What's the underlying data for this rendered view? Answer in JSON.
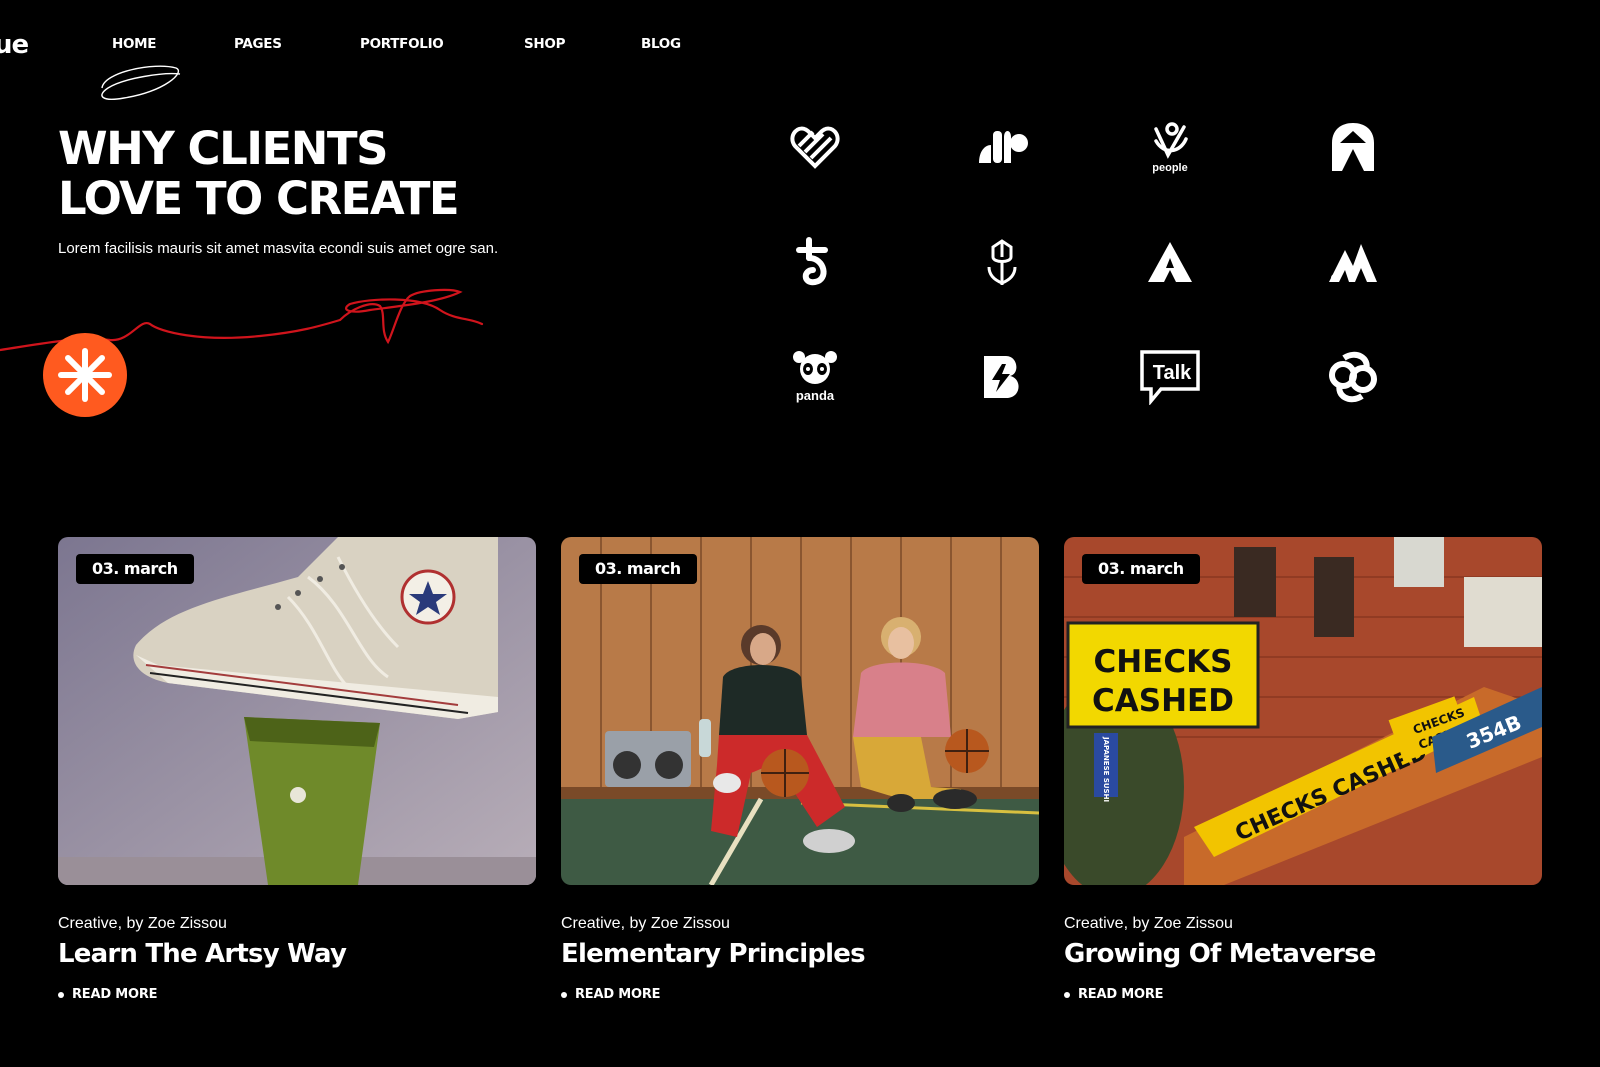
{
  "brand": {
    "logo_fragment": "ue"
  },
  "nav": {
    "items": [
      {
        "label": "HOME",
        "active": true
      },
      {
        "label": "PAGES"
      },
      {
        "label": "PORTFOLIO"
      },
      {
        "label": "SHOP"
      },
      {
        "label": "BLOG"
      }
    ]
  },
  "hero": {
    "title_line1": "WHY CLIENTS",
    "title_line2": "LOVE TO CREATE",
    "subtitle": "Lorem facilisis mauris sit amet masvita econdi suis amet ogre san.",
    "accent_color": "#ff5a1f",
    "scribble_color": "#d0141c"
  },
  "client_logos": [
    {
      "icon": "heart-stripes-icon"
    },
    {
      "icon": "abstract-blob-icon"
    },
    {
      "icon": "people-logo-icon",
      "text": "people"
    },
    {
      "icon": "arch-logo-icon"
    },
    {
      "icon": "t-loop-icon"
    },
    {
      "icon": "tulip-icon"
    },
    {
      "icon": "a-triangle-icon"
    },
    {
      "icon": "m-peaks-icon"
    },
    {
      "icon": "panda-logo-icon",
      "text": "panda"
    },
    {
      "icon": "b-bolt-icon"
    },
    {
      "icon": "talk-bubble-icon",
      "text": "Talk"
    },
    {
      "icon": "knot-icon"
    }
  ],
  "posts": [
    {
      "date": "03. march",
      "meta": "Creative, by Zoe Zissou",
      "title": "Learn The Artsy Way",
      "read_more": "READ MORE",
      "image": "sneaker-photo"
    },
    {
      "date": "03. march",
      "meta": "Creative, by Zoe Zissou",
      "title": "Elementary Principles",
      "read_more": "READ MORE",
      "image": "basketball-girls-photo"
    },
    {
      "date": "03. march",
      "meta": "Creative, by Zoe Zissou",
      "title": "Growing Of Metaverse",
      "read_more": "READ MORE",
      "image": "checks-cashed-street-photo",
      "image_text": {
        "sign1": "CHECKS",
        "sign2": "CASHED",
        "awning": "CHECKS CASHED",
        "small1": "CHECKS",
        "small2": "CASHE",
        "street": "354B",
        "vertical": "JAPANESE SUSHI"
      }
    }
  ]
}
